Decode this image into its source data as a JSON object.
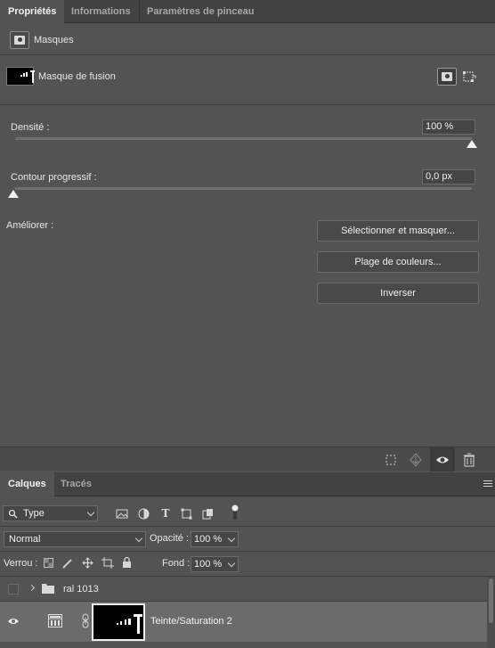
{
  "properties_panel": {
    "tabs": [
      {
        "label": "Propriétés",
        "active": true
      },
      {
        "label": "Informations",
        "active": false
      },
      {
        "label": "Paramètres de pinceau",
        "active": false
      }
    ],
    "section_title": "Masques",
    "mask_name": "Masque de fusion",
    "density": {
      "label": "Densité :",
      "value": "100 %",
      "fraction": 1.0
    },
    "feather": {
      "label": "Contour progressif :",
      "value": "0,0 px",
      "fraction": 0.0
    },
    "refine": {
      "label": "Améliorer :",
      "buttons": [
        "Sélectionner et masquer...",
        "Plage de couleurs...",
        "Inverser"
      ]
    },
    "bottom_icons": [
      "selection-from-mask-icon",
      "apply-mask-icon",
      "eye-icon",
      "trash-icon"
    ]
  },
  "layers_panel": {
    "tabs": [
      {
        "label": "Calques",
        "active": true
      },
      {
        "label": "Tracés",
        "active": false
      }
    ],
    "filter": {
      "value": "Type"
    },
    "filter_icons": [
      "image-filter-icon",
      "adjustment-filter-icon",
      "type-filter-icon",
      "shape-filter-icon",
      "smart-object-filter-icon",
      "filter-toggle-icon"
    ],
    "blend_mode": "Normal",
    "opacity": {
      "label": "Opacité :",
      "value": "100 %"
    },
    "lock": {
      "label": "Verrou :"
    },
    "fill": {
      "label": "Fond :",
      "value": "100 %"
    },
    "layers": [
      {
        "name": "ral 1013",
        "type": "group",
        "visible": false,
        "selected": false
      },
      {
        "name": "Teinte/Saturation 2",
        "type": "adjustment",
        "visible": true,
        "selected": true
      }
    ]
  },
  "colors": {
    "panel_bg": "#535353",
    "tabbar_bg": "#424242",
    "selected_row": "#6b6b6b"
  }
}
